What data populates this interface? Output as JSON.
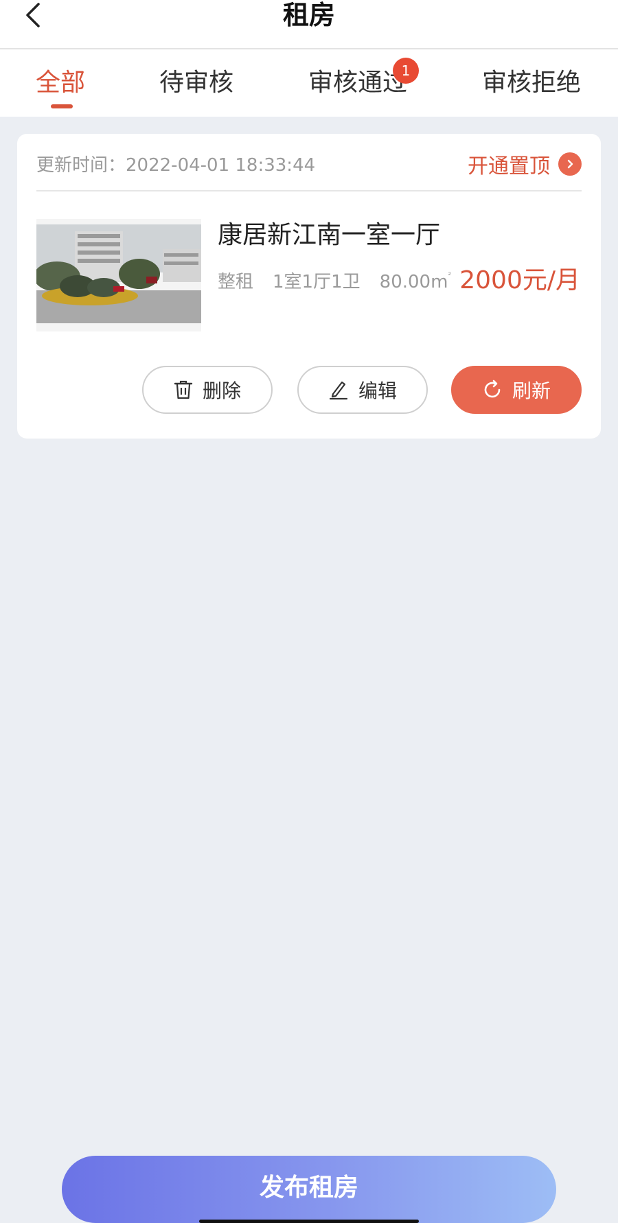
{
  "header": {
    "title": "租房",
    "back_icon": "chevron-left-icon"
  },
  "tabs": [
    {
      "label": "全部",
      "active": true
    },
    {
      "label": "待审核",
      "active": false
    },
    {
      "label": "审核通过",
      "active": false,
      "badge": "1"
    },
    {
      "label": "审核拒绝",
      "active": false
    }
  ],
  "listing": {
    "updated_label": "更新时间：",
    "updated_time": "2022-04-01 18:33:44",
    "promote_label": "开通置顶",
    "title": "康居新江南一室一厅",
    "rent_type": "整租",
    "layout": "1室1厅1卫",
    "area": "80.00m",
    "area_unit_sup": "²",
    "price": "2000元/月",
    "actions": {
      "delete": "删除",
      "edit": "编辑",
      "refresh": "刷新"
    }
  },
  "footer": {
    "publish_label": "发布租房"
  },
  "colors": {
    "accent": "#d9543a",
    "refresh_button": "#e8674f",
    "badge": "#e84a33",
    "background": "#ebeef3",
    "publish_gradient_start": "#6b73e6",
    "publish_gradient_end": "#9dbdf5"
  }
}
